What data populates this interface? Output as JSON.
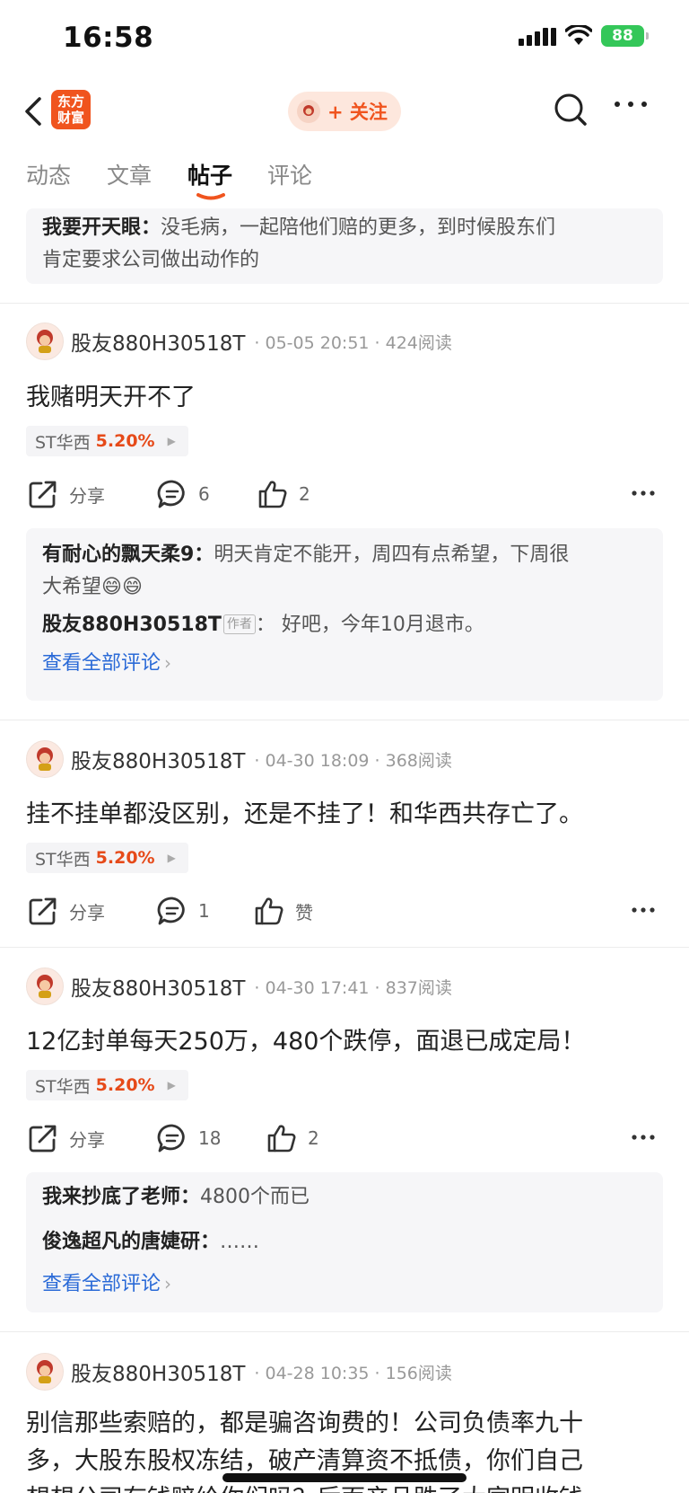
{
  "status": {
    "time": "16:58",
    "battery": "88"
  },
  "nav": {
    "logo": "东方财富",
    "follow": "+ 关注"
  },
  "tabs": [
    "动态",
    "文章",
    "帖子",
    "评论"
  ],
  "top_comment": {
    "user": "我要开天眼：",
    "text": "没毛病，一起陪他们赔的更多，到时候股东们",
    "text2": "肯定要求公司做出动作的"
  },
  "colors": {
    "accent": "#f0541e",
    "link": "#2a6ad7",
    "up": "#e64a19"
  },
  "posts": [
    {
      "username": "股友880H30518T",
      "meta": "· 05-05 20:51 · 424阅读",
      "title": "我赌明天开不了",
      "stock": {
        "name": "ST华西",
        "pct": "5.20%"
      },
      "actions": {
        "share": "分享",
        "comments": "6",
        "likes": "2"
      },
      "comments": {
        "c1_user": "有耐心的飘天柔9：",
        "c1_text": "明天肯定不能开，周四有点希望，下周很",
        "c1_text2": "大希望",
        "c1_emoji": "😄😄",
        "c2_user": "股友880H30518T",
        "c2_tag": "作者",
        "c2_text": "：  好吧，今年10月退市。",
        "view_all": "查看全部评论"
      }
    },
    {
      "username": "股友880H30518T",
      "meta": "· 04-30 18:09 · 368阅读",
      "title": "挂不挂单都没区别，还是不挂了！和华西共存亡了。",
      "stock": {
        "name": "ST华西",
        "pct": "5.20%"
      },
      "actions": {
        "share": "分享",
        "comments": "1",
        "likes": "赞"
      }
    },
    {
      "username": "股友880H30518T",
      "meta": "· 04-30 17:41 · 837阅读",
      "title": "12亿封单每天250万，480个跌停，面退已成定局！",
      "stock": {
        "name": "ST华西",
        "pct": "5.20%"
      },
      "actions": {
        "share": "分享",
        "comments": "18",
        "likes": "2"
      },
      "comments": {
        "c1_user": "我来抄底了老师：",
        "c1_text": "4800个而已",
        "c2_user": "俊逸超凡的唐婕研：",
        "c2_text": "……",
        "view_all": "查看全部评论"
      }
    },
    {
      "username": "股友880H30518T",
      "meta": "· 04-28 10:35 · 156阅读",
      "body_line1": "别信那些索赔的，都是骗咨询费的！公司负债率九十",
      "body_line2": "多，大股东股权冻结，破产清算资不抵债，你们自己",
      "body_line3": "想想公司有钱赔给你们吗？后面产品跌了大家明收钱"
    }
  ]
}
